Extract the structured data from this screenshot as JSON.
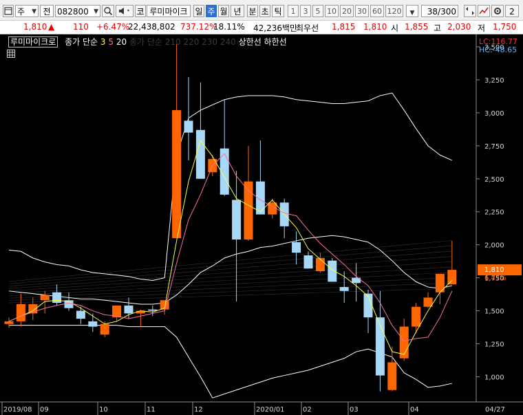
{
  "toolbar": {
    "period_sel": "주",
    "market_sel": "전",
    "code": "082800",
    "market_btn": "코",
    "name": "루미마이크",
    "tabs": [
      "일",
      "주",
      "월",
      "년",
      "분",
      "초",
      "틱"
    ],
    "active_tab": "주",
    "numbers": [
      "1",
      "3",
      "5",
      "10",
      "20",
      "30",
      "60",
      "120"
    ],
    "count": "38",
    "count_total": "/300",
    "edge_char": "2"
  },
  "info": {
    "price": "1,810",
    "arrow": "▲",
    "change": "110",
    "change_pct": "+6.47%",
    "volume": "22,438,802",
    "volume_ratio": "737.12%",
    "turnover": "18.11%",
    "amount": "42,236백만",
    "best_label": "최우선",
    "ask": "1,815",
    "bid": "1,810",
    "open_label": "시",
    "open": "1,855",
    "high_label": "고",
    "high": "2,030",
    "low_label": "저",
    "low": "1,750"
  },
  "chart_header": {
    "name": "루미마이크로",
    "indicator": "종가 단순",
    "ma": [
      "3",
      "5",
      "20"
    ],
    "faded": "종가 단순 210 220 230 240",
    "limits": "상한선 하한선",
    "lc": "LC:116.77",
    "hc": "HC:-48.65"
  },
  "colors": {
    "up": "#ff6600",
    "down": "#a8d8f8",
    "yellow": "#ffff40",
    "pink": "#ff70a0",
    "white": "#ffffff",
    "grid": "#3a3a3a",
    "current": "#ff6600"
  },
  "chart_data": {
    "type": "candlestick",
    "price_axis": {
      "ylim": [
        820,
        3500
      ],
      "ticks": [
        1000,
        1250,
        1500,
        1750,
        2000,
        2250,
        2500,
        2750,
        3000,
        3250
      ]
    },
    "price_labels": [
      "1,000",
      "1,250",
      "1,500",
      "1,750",
      "2,000",
      "2,250",
      "2,500",
      "2,750",
      "3,000",
      "3,250",
      "3,500"
    ],
    "current_price": "1,810",
    "current_pct": "6.47%",
    "x_labels": [
      "2019/08",
      "09",
      "10",
      "11",
      "12",
      "2020/01",
      "02",
      "03",
      "04",
      "04/27"
    ],
    "candles": [
      {
        "o": 1400,
        "h": 1450,
        "l": 1370,
        "c": 1420
      },
      {
        "o": 1420,
        "h": 1630,
        "l": 1380,
        "c": 1550
      },
      {
        "o": 1480,
        "h": 1600,
        "l": 1430,
        "c": 1550
      },
      {
        "o": 1580,
        "h": 1650,
        "l": 1480,
        "c": 1620
      },
      {
        "o": 1640,
        "h": 1700,
        "l": 1540,
        "c": 1560
      },
      {
        "o": 1580,
        "h": 1640,
        "l": 1500,
        "c": 1520
      },
      {
        "o": 1500,
        "h": 1530,
        "l": 1400,
        "c": 1440
      },
      {
        "o": 1420,
        "h": 1480,
        "l": 1340,
        "c": 1380
      },
      {
        "o": 1320,
        "h": 1420,
        "l": 1300,
        "c": 1400
      },
      {
        "o": 1450,
        "h": 1500,
        "l": 1420,
        "c": 1540
      },
      {
        "o": 1540,
        "h": 1600,
        "l": 1440,
        "c": 1480
      },
      {
        "o": 1480,
        "h": 1510,
        "l": 1380,
        "c": 1500
      },
      {
        "o": 1510,
        "h": 1540,
        "l": 1460,
        "c": 1500
      },
      {
        "o": 1510,
        "h": 1560,
        "l": 1470,
        "c": 1580
      },
      {
        "o": 2050,
        "h": 3520,
        "l": 2050,
        "c": 3020
      },
      {
        "o": 2940,
        "h": 3270,
        "l": 2640,
        "c": 2850
      },
      {
        "o": 2870,
        "h": 3230,
        "l": 2500,
        "c": 2500
      },
      {
        "o": 2550,
        "h": 2680,
        "l": 2520,
        "c": 2650
      },
      {
        "o": 2730,
        "h": 3100,
        "l": 2370,
        "c": 2380
      },
      {
        "o": 2340,
        "h": 2560,
        "l": 1570,
        "c": 2040
      },
      {
        "o": 2040,
        "h": 2750,
        "l": 2030,
        "c": 2480
      },
      {
        "o": 2480,
        "h": 2790,
        "l": 2240,
        "c": 2230
      },
      {
        "o": 2230,
        "h": 2350,
        "l": 2200,
        "c": 2320
      },
      {
        "o": 2320,
        "h": 2350,
        "l": 2050,
        "c": 2140
      },
      {
        "o": 2020,
        "h": 2100,
        "l": 1850,
        "c": 1940
      },
      {
        "o": 1920,
        "h": 1950,
        "l": 1820,
        "c": 1820
      },
      {
        "o": 1800,
        "h": 1940,
        "l": 1790,
        "c": 1900
      },
      {
        "o": 1880,
        "h": 1900,
        "l": 1730,
        "c": 1720
      },
      {
        "o": 1680,
        "h": 1800,
        "l": 1560,
        "c": 1650
      },
      {
        "o": 1750,
        "h": 1860,
        "l": 1570,
        "c": 1710
      },
      {
        "o": 1630,
        "h": 1660,
        "l": 1330,
        "c": 1450
      },
      {
        "o": 1450,
        "h": 1650,
        "l": 890,
        "c": 1010
      },
      {
        "o": 900,
        "h": 1230,
        "l": 890,
        "c": 1110
      },
      {
        "o": 1140,
        "h": 1440,
        "l": 1120,
        "c": 1380
      },
      {
        "o": 1380,
        "h": 1560,
        "l": 1330,
        "c": 1530
      },
      {
        "o": 1530,
        "h": 1640,
        "l": 1520,
        "c": 1600
      },
      {
        "o": 1640,
        "h": 1760,
        "l": 1550,
        "c": 1780
      },
      {
        "o": 1700,
        "h": 2030,
        "l": 1750,
        "c": 1810
      }
    ],
    "ma3": [
      1420,
      1460,
      1500,
      1570,
      1580,
      1570,
      1520,
      1460,
      1400,
      1420,
      1470,
      1500,
      1490,
      1520,
      2030,
      2480,
      2790,
      2670,
      2510,
      2350,
      2300,
      2250,
      2340,
      2230,
      2130,
      1970,
      1890,
      1810,
      1760,
      1690,
      1610,
      1390,
      1190,
      1170,
      1340,
      1500,
      1640,
      1730
    ],
    "ma5": [
      1420,
      1460,
      1490,
      1520,
      1540,
      1560,
      1540,
      1500,
      1470,
      1460,
      1440,
      1460,
      1480,
      1500,
      1860,
      2190,
      2380,
      2600,
      2690,
      2520,
      2410,
      2340,
      2290,
      2240,
      2220,
      2110,
      2010,
      1930,
      1850,
      1760,
      1690,
      1560,
      1390,
      1270,
      1290,
      1300,
      1450,
      1650
    ],
    "upper_band": [
      1960,
      1950,
      1900,
      1870,
      1850,
      1840,
      1810,
      1790,
      1780,
      1770,
      1760,
      1740,
      1730,
      1750,
      2680,
      2960,
      3020,
      3060,
      3100,
      3120,
      3130,
      3130,
      3130,
      3120,
      3100,
      3090,
      3080,
      3070,
      3070,
      3080,
      3090,
      3130,
      3150,
      3020,
      2880,
      2750,
      2680,
      2640
    ],
    "lower_band": [
      1390,
      1390,
      1390,
      1390,
      1390,
      1390,
      1390,
      1390,
      1390,
      1390,
      1380,
      1380,
      1380,
      1380,
      1300,
      1150,
      1000,
      840,
      870,
      900,
      930,
      960,
      990,
      1010,
      1030,
      1050,
      1080,
      1110,
      1140,
      1190,
      1210,
      1180,
      1150,
      1030,
      980,
      920,
      930,
      950
    ],
    "mid_band": [
      1650,
      1640,
      1630,
      1620,
      1610,
      1600,
      1590,
      1590,
      1580,
      1570,
      1560,
      1550,
      1550,
      1560,
      1620,
      1700,
      1790,
      1840,
      1900,
      1930,
      1950,
      1980,
      1990,
      2010,
      2030,
      2050,
      2060,
      2070,
      2060,
      2040,
      2020,
      1960,
      1880,
      1790,
      1720,
      1680,
      1670,
      1690
    ]
  }
}
